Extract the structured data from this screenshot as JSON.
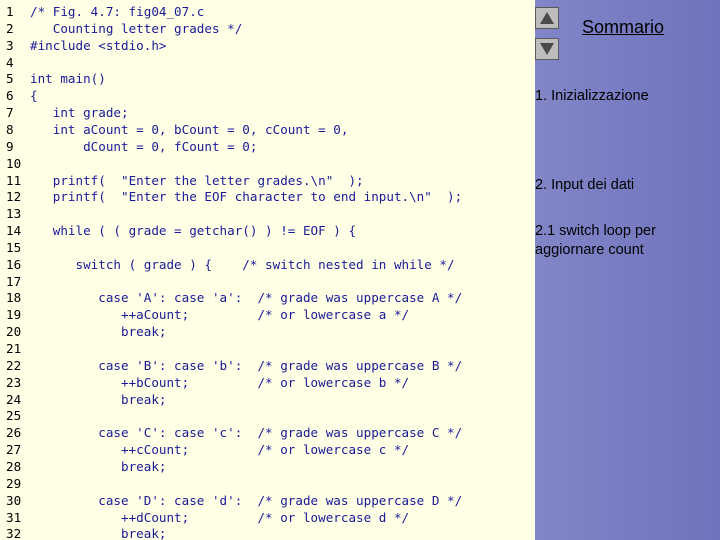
{
  "code_lines": [
    {
      "n": "1",
      "text": "/* Fig. 4.7: fig04_07.c"
    },
    {
      "n": "2",
      "text": "   Counting letter grades */"
    },
    {
      "n": "3",
      "text": "#include <stdio.h>"
    },
    {
      "n": "4",
      "text": ""
    },
    {
      "n": "5",
      "text": "int main()"
    },
    {
      "n": "6",
      "text": "{"
    },
    {
      "n": "7",
      "text": "   int grade;"
    },
    {
      "n": "8",
      "text": "   int aCount = 0, bCount = 0, cCount = 0,"
    },
    {
      "n": "9",
      "text": "       dCount = 0, fCount = 0;"
    },
    {
      "n": "10",
      "text": ""
    },
    {
      "n": "11",
      "text": "   printf(  \"Enter the letter grades.\\n\"  );"
    },
    {
      "n": "12",
      "text": "   printf(  \"Enter the EOF character to end input.\\n\"  );"
    },
    {
      "n": "13",
      "text": ""
    },
    {
      "n": "14",
      "text": "   while ( ( grade = getchar() ) != EOF ) {"
    },
    {
      "n": "15",
      "text": ""
    },
    {
      "n": "16",
      "text": "      switch ( grade ) {    /* switch nested in while */"
    },
    {
      "n": "17",
      "text": ""
    },
    {
      "n": "18",
      "text": "         case 'A': case 'a':  /* grade was uppercase A */"
    },
    {
      "n": "19",
      "text": "            ++aCount;         /* or lowercase a */"
    },
    {
      "n": "20",
      "text": "            break;"
    },
    {
      "n": "21",
      "text": ""
    },
    {
      "n": "22",
      "text": "         case 'B': case 'b':  /* grade was uppercase B */"
    },
    {
      "n": "23",
      "text": "            ++bCount;         /* or lowercase b */"
    },
    {
      "n": "24",
      "text": "            break;"
    },
    {
      "n": "25",
      "text": ""
    },
    {
      "n": "26",
      "text": "         case 'C': case 'c':  /* grade was uppercase C */"
    },
    {
      "n": "27",
      "text": "            ++cCount;         /* or lowercase c */"
    },
    {
      "n": "28",
      "text": "            break;"
    },
    {
      "n": "29",
      "text": ""
    },
    {
      "n": "30",
      "text": "         case 'D': case 'd':  /* grade was uppercase D */"
    },
    {
      "n": "31",
      "text": "            ++dCount;         /* or lowercase d */"
    },
    {
      "n": "32",
      "text": "            break;"
    }
  ],
  "nav": {
    "up_icon": "triangle-up-icon",
    "down_icon": "triangle-down-icon"
  },
  "sidebar": {
    "title": "Sommario",
    "notes": [
      "1.  Inizializzazione",
      "2.  Input dei dati",
      "2.1  switch loop per aggiornare count"
    ]
  },
  "colors": {
    "code_text": "#1a1a99",
    "code_bg": "#ffffe6",
    "nav_button": "#bdbdbd"
  }
}
